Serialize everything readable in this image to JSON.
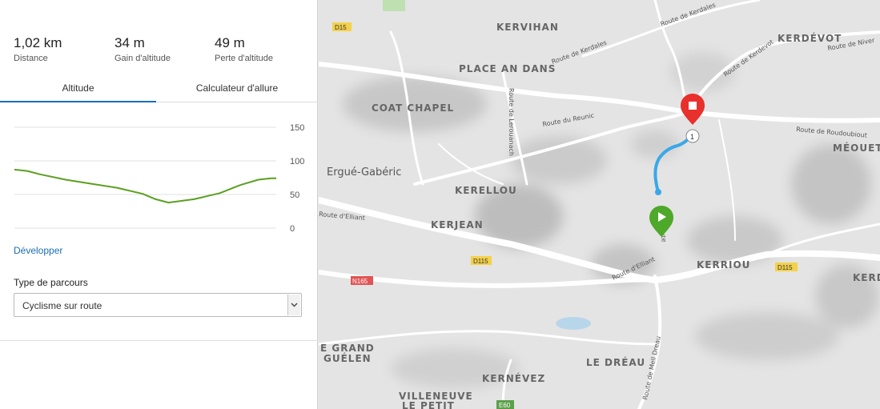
{
  "stats": [
    {
      "value": "1,02 km",
      "label": "Distance"
    },
    {
      "value": "34 m",
      "label": "Gain d'altitude"
    },
    {
      "value": "49 m",
      "label": "Perte d'altitude"
    }
  ],
  "tabs": [
    {
      "label": "Altitude",
      "active": true
    },
    {
      "label": "Calculateur d'allure",
      "active": false
    }
  ],
  "chart_data": {
    "type": "line",
    "x": [
      0,
      0.05,
      0.1,
      0.2,
      0.3,
      0.4,
      0.5,
      0.55,
      0.6,
      0.7,
      0.8,
      0.88,
      0.95,
      1.0,
      1.02
    ],
    "y": [
      87,
      85,
      80,
      72,
      66,
      60,
      51,
      43,
      38,
      43,
      52,
      64,
      72,
      74,
      74
    ],
    "yticks": [
      "150",
      "100",
      "50",
      "0"
    ],
    "ylim": [
      0,
      150
    ],
    "color": "#5aa020"
  },
  "develop_link": "Développer",
  "route_type": {
    "label": "Type de parcours",
    "selected": "Cyclisme sur route"
  },
  "map": {
    "places": [
      "KERVIHAN",
      "PLACE AN DANS",
      "COAT CHAPEL",
      "KERELLOU",
      "KERJEAN",
      "KERRIOU",
      "KERDÉVOT",
      "MÉOUET",
      "LE DRÉAU",
      "KERNÉVEZ",
      "VILLENEUVE",
      "LE PETIT",
      "E GRAND",
      "GUÉLEN",
      "KERD"
    ],
    "town": "Ergué-Gabéric",
    "roads": [
      "Route de Kerdales",
      "Route de Kerdales",
      "Route de Kerdevot",
      "Route de Niver",
      "Route du Reunic",
      "Route de Lerouanach",
      "Route de Roudoubiout",
      "Route d'Elliant",
      "Route d'Elliant",
      "Route de Mell Dreau",
      "Route"
    ],
    "shields": [
      "D15",
      "D115",
      "N165",
      "D115",
      "E60"
    ],
    "waypoint": "1",
    "route_color": "#3aa8e8",
    "start_color": "#4ea82a",
    "end_color": "#e8302c"
  }
}
